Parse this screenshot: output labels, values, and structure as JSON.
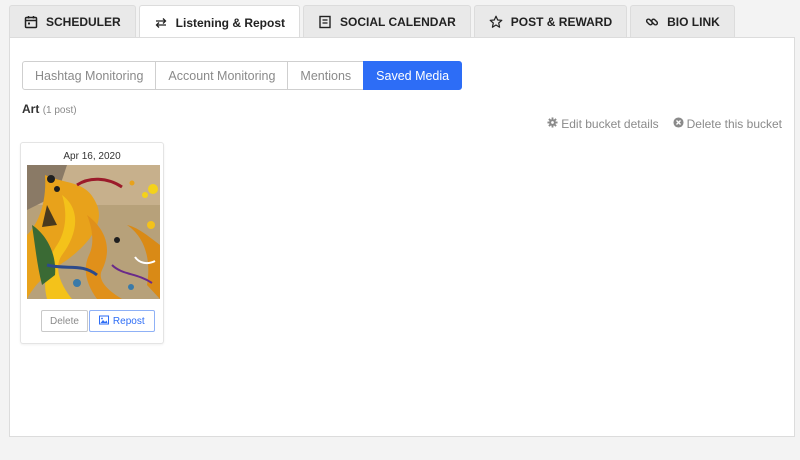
{
  "top_tabs": [
    {
      "label": "SCHEDULER",
      "icon": "calendar-icon"
    },
    {
      "label": "Listening & Repost",
      "icon": "repost-icon",
      "active": true
    },
    {
      "label": "SOCIAL CALENDAR",
      "icon": "social-calendar-icon"
    },
    {
      "label": "POST & REWARD",
      "icon": "star-icon"
    },
    {
      "label": "BIO LINK",
      "icon": "link-icon"
    }
  ],
  "sub_tabs": [
    {
      "label": "Hashtag Monitoring"
    },
    {
      "label": "Account Monitoring"
    },
    {
      "label": "Mentions"
    },
    {
      "label": "Saved Media",
      "active": true
    }
  ],
  "bucket": {
    "name": "Art",
    "count": "(1 post)",
    "edit_label": "Edit bucket details",
    "delete_label": "Delete this bucket"
  },
  "posts": [
    {
      "date": "Apr 16, 2020",
      "delete_label": "Delete",
      "repost_label": "Repost"
    }
  ],
  "colors": {
    "accent": "#2d6df6",
    "muted_text": "#8a8a8a",
    "tab_bg": "#e9e9e9"
  }
}
